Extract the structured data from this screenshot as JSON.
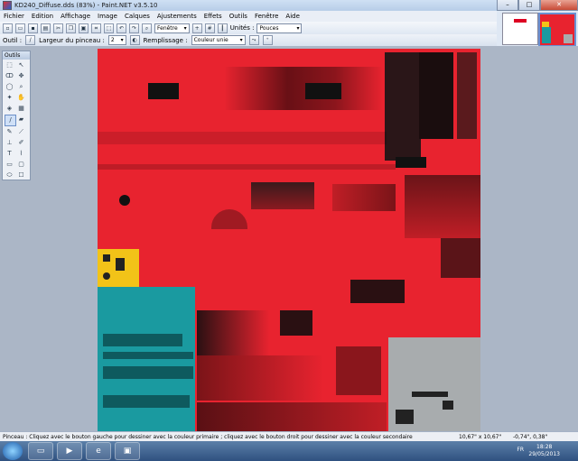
{
  "window": {
    "title": "KD240_Diffuse.dds (83%) - Paint.NET v3.5.10",
    "minimize": "–",
    "maximize": "□",
    "close": "✕"
  },
  "menu": [
    "Fichier",
    "Edition",
    "Affichage",
    "Image",
    "Calques",
    "Ajustements",
    "Effets",
    "Outils",
    "Fenêtre",
    "Aide"
  ],
  "toolbar": {
    "zoom_mode": "Fenêtre",
    "units_label": "Unités :",
    "units_value": "Pouces"
  },
  "tool_options": {
    "tool_label": "Outil :",
    "brush_width_label": "Largeur du pinceau :",
    "brush_width_value": "2",
    "fill_label": "Remplissage :",
    "fill_value": "Couleur unie"
  },
  "tools_panel": {
    "title": "Outils"
  },
  "status": {
    "message": "Pinceau : Cliquez avec le bouton gauche pour dessiner avec la couleur primaire ; cliquez avec le bouton droit pour dessiner avec la couleur secondaire",
    "image_size": "10,67\" x 10,67\"",
    "cursor_coords": "-0,74\", 0,38\""
  },
  "taskbar": {
    "lang": "FR",
    "time": "18:28",
    "date": "29/05/2013"
  },
  "colors": {
    "texture_red": "#e8232f",
    "texture_teal": "#1a9aa0",
    "texture_yellow": "#f2c318",
    "texture_gray": "#a8acae"
  }
}
